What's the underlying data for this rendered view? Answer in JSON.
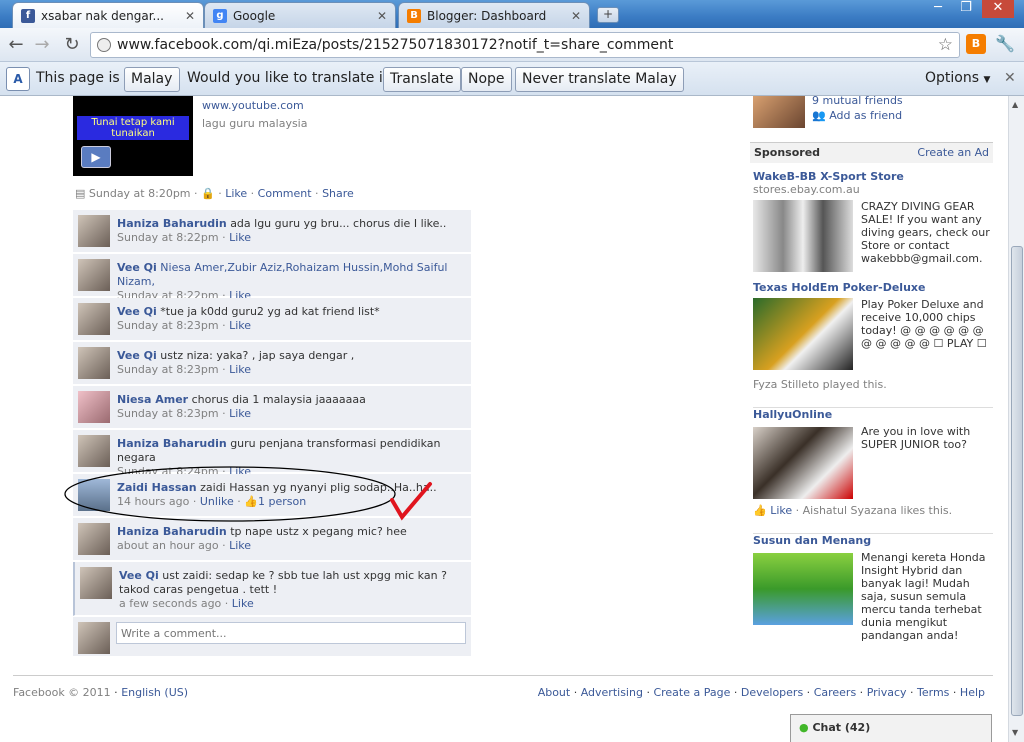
{
  "browser": {
    "tabs": [
      {
        "label": "xsabar nak dengar...",
        "fav": "f"
      },
      {
        "label": "Google",
        "fav": "g"
      },
      {
        "label": "Blogger: Dashboard",
        "fav": "B"
      }
    ],
    "url": "www.facebook.com/qi.miEza/posts/215275071830172?notif_t=share_comment"
  },
  "translate_bar": {
    "page_is_in": "This page is in",
    "language": "Malay",
    "question": "Would you like to translate it?",
    "translate": "Translate",
    "nope": "Nope",
    "never": "Never translate Malay",
    "options": "Options"
  },
  "post": {
    "link_url": "www.youtube.com",
    "link_desc": "lagu guru malaysia",
    "video_text": "Tunai tetap kami tunaikan",
    "time": "Sunday at 8:20pm",
    "like": "Like",
    "comment": "Comment",
    "share": "Share"
  },
  "comments": [
    {
      "name": "Haniza Baharudin",
      "text": "ada lgu guru yg bru... chorus die I like..",
      "time": "Sunday at 8:22pm",
      "action": "Like"
    },
    {
      "name": "Vee Qi",
      "text": "Niesa Amer,Zubir Aziz,Rohaizam Hussin,Mohd Saiful Nizam,",
      "time": "Sunday at 8:22pm",
      "action": "Like"
    },
    {
      "name": "Vee Qi",
      "text": "*tue ja k0dd guru2 yg ad kat friend list*",
      "time": "Sunday at 8:23pm",
      "action": "Like"
    },
    {
      "name": "Vee Qi",
      "text": "ustz niza: yaka? , jap saya dengar ,",
      "time": "Sunday at 8:23pm",
      "action": "Like"
    },
    {
      "name": "Niesa Amer",
      "text": "chorus dia 1 malaysia jaaaaaaa",
      "time": "Sunday at 8:23pm",
      "action": "Like"
    },
    {
      "name": "Haniza Baharudin",
      "text": "guru penjana transformasi pendidikan negara",
      "time": "Sunday at 8:24pm",
      "action": "Like"
    },
    {
      "name": "Zaidi Hassan",
      "text": "zaidi Hassan yg nyanyi plig sodap..Ha..ha..",
      "time": "14 hours ago",
      "action": "Unlike",
      "likes": "1 person"
    },
    {
      "name": "Haniza Baharudin",
      "text": "tp nape ustz x pegang mic? hee",
      "time": "about an hour ago",
      "action": "Like"
    },
    {
      "name": "Vee Qi",
      "text": "ust zaidi: sedap ke ? sbb tue lah ust xpgg mic kan ? takod caras pengetua . tett !",
      "time": "a few seconds ago",
      "action": "Like"
    }
  ],
  "write_comment": "Write a comment...",
  "sidebar": {
    "mutual": "9 mutual friends",
    "add_friend": "Add as friend",
    "sponsored": "Sponsored",
    "create_ad": "Create an Ad",
    "ads": [
      {
        "title": "WakeB-BB X-Sport Store",
        "sub": "stores.ebay.com.au",
        "text": "CRAZY DIVING GEAR SALE! If you want any diving gears, check our Store or contact wakebbb@gmail.com."
      },
      {
        "title": "Texas HoldEm Poker-Deluxe",
        "text": "Play Poker Deluxe and receive 10,000 chips today! @ @ @ @ @ @ @ @ @ @ @ ☐ PLAY ☐",
        "social": "Fyza Stilleto played this."
      },
      {
        "title": "HallyuOnline",
        "text": "Are you in love with SUPER JUNIOR too?",
        "like": "Like",
        "social": "Aishatul Syazana likes this."
      },
      {
        "title": "Susun dan Menang",
        "text": "Menangi kereta Honda Insight Hybrid dan banyak lagi! Mudah saja, susun semula mercu tanda terhebat dunia mengikut pandangan anda!"
      }
    ]
  },
  "footer": {
    "copyright": "Facebook © 2011",
    "language": "English (US)",
    "links": [
      "About",
      "Advertising",
      "Create a Page",
      "Developers",
      "Careers",
      "Privacy",
      "Terms",
      "Help"
    ]
  },
  "chat": "Chat (42)",
  "colors": {
    "fb_blue": "#3b5998",
    "comment_bg": "#edeff4",
    "annotation": "#e0141e"
  }
}
